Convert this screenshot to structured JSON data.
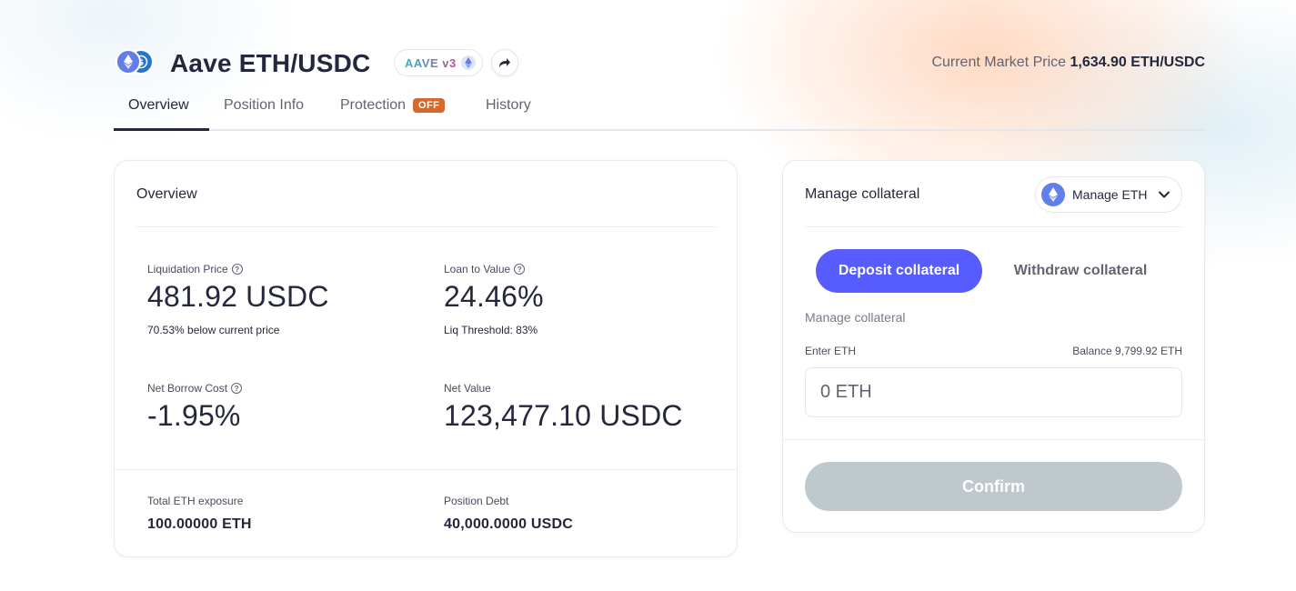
{
  "header": {
    "title": "Aave ETH/USDC",
    "protocol_badge": "AAVE v3",
    "market_price_label": "Current Market Price",
    "market_price_value": "1,634.90 ETH/USDC"
  },
  "tabs": [
    {
      "label": "Overview",
      "active": true
    },
    {
      "label": "Position Info",
      "active": false
    },
    {
      "label": "Protection",
      "active": false,
      "badge": "OFF"
    },
    {
      "label": "History",
      "active": false
    }
  ],
  "overview": {
    "title": "Overview",
    "liquidation_price": {
      "label": "Liquidation Price",
      "value": "481.92 USDC",
      "sub": "70.53% below current price"
    },
    "loan_to_value": {
      "label": "Loan to Value",
      "value": "24.46%",
      "sub": "Liq Threshold: 83%"
    },
    "net_borrow_cost": {
      "label": "Net Borrow Cost",
      "value": "-1.95%"
    },
    "net_value": {
      "label": "Net Value",
      "value": "123,477.10 USDC"
    },
    "total_exposure": {
      "label": "Total ETH exposure",
      "value": "100.00000 ETH"
    },
    "position_debt": {
      "label": "Position Debt",
      "value": "40,000.0000 USDC"
    }
  },
  "manage": {
    "title": "Manage collateral",
    "select_label": "Manage ETH",
    "deposit_label": "Deposit collateral",
    "withdraw_label": "Withdraw collateral",
    "subtitle": "Manage collateral",
    "input_label": "Enter ETH",
    "balance": "Balance 9,799.92 ETH",
    "input_placeholder": "0 ETH",
    "confirm_label": "Confirm"
  },
  "colors": {
    "accent": "#575cfe",
    "off_badge": "#d7682d",
    "confirm_disabled": "#bec8cd",
    "eth": "#627eea",
    "usdc": "#2775ca"
  },
  "icons": [
    "eth-icon",
    "usdc-icon",
    "share-icon",
    "help-icon",
    "chevron-down-icon"
  ]
}
